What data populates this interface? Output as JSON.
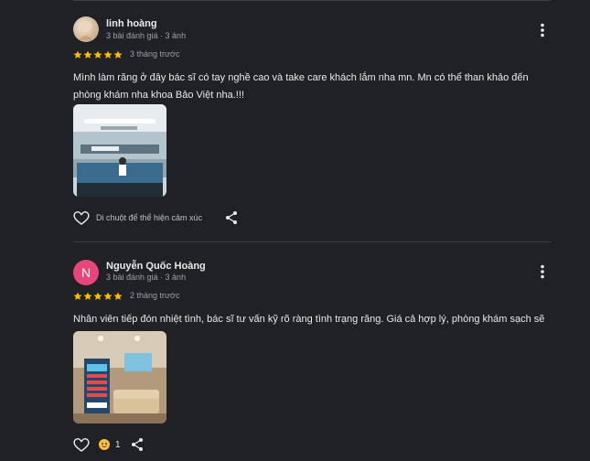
{
  "reviews": [
    {
      "avatar": {
        "type": "photo",
        "letter": "",
        "color": "#d9c2a6"
      },
      "name": "linh hoàng",
      "meta": "3 bài đánh giá · 3 ảnh",
      "rating": 5,
      "date": "3 tháng trước",
      "text": "Mình làm răng ở đây bác sĩ có tay nghề cao và take care khách lắm nha mn. Mn có thể than khảo đến phòng khám nha khoa Bảo Việt nha.!!!",
      "photo_icon": "clinic-reception-photo",
      "reaction_hint": "Di chuột để thể hiện cảm xúc",
      "reaction_count": ""
    },
    {
      "avatar": {
        "type": "letter",
        "letter": "N",
        "color": "#e8457a"
      },
      "name": "Nguyễn Quốc Hoàng",
      "meta": "3 bài đánh giá · 3 ảnh",
      "rating": 5,
      "date": "2 tháng trước",
      "text": "Nhân viên tiếp đón nhiệt tình, bác sĩ tư vấn kỹ rõ ràng tình trạng răng. Giá cả hợp lý, phòng khám sạch sẽ",
      "photo_icon": "clinic-waiting-room-photo",
      "reaction_hint": "",
      "reaction_count": "1"
    }
  ],
  "colors": {
    "star": "#fbbc04",
    "background": "#202124",
    "divider": "#3c4043",
    "accent": "#e8457a"
  }
}
